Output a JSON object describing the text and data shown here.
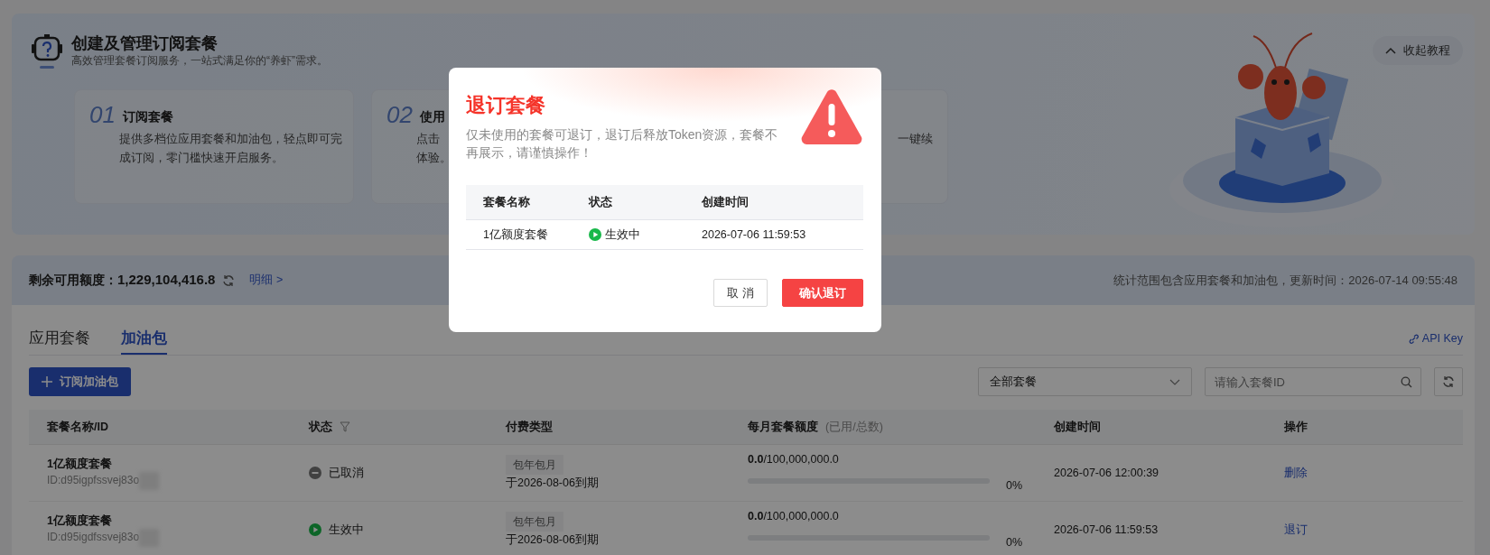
{
  "banner": {
    "title": "创建及管理订阅套餐",
    "subtitle": "高效管理套餐订阅服务，一站式满足你的“养虾”需求。",
    "collapse_button": "收起教程",
    "steps": [
      {
        "number": "01",
        "title": "订阅套餐",
        "lines": [
          "提供多档位应用套餐和加油包，轻点即可完",
          "成订阅，零门槛快速开启服务。"
        ]
      },
      {
        "number": "02",
        "title": "使用",
        "lines": [
          "点击",
          "体验。"
        ]
      },
      {
        "lines": [
          "一键续"
        ]
      }
    ]
  },
  "quota": {
    "label": "剩余可用额度：",
    "value": "1,229,104,416.8",
    "detail_link": "明细 >",
    "note": "统计范围包含应用套餐和加油包，更新时间：2026-07-14 09:55:48"
  },
  "tabs": [
    {
      "label": "应用套餐",
      "selected": false
    },
    {
      "label": "加油包",
      "selected": true
    }
  ],
  "api_key_link": "API Key",
  "subscribe_button": "订阅加油包",
  "filter_select": {
    "value": "全部套餐"
  },
  "search": {
    "placeholder": "请输入套餐ID"
  },
  "table": {
    "columns": [
      {
        "label": "套餐名称/ID"
      },
      {
        "label": "状态",
        "filter": true
      },
      {
        "label": "付费类型"
      },
      {
        "label": "每月套餐额度",
        "hint": "(已用/总数)"
      },
      {
        "label": "创建时间"
      },
      {
        "label": "操作"
      }
    ],
    "rows": [
      {
        "name": "1亿额度套餐",
        "id": "ID:d95igpfssvej83o",
        "status": "已取消",
        "kind": "cancelled",
        "billing_tag": "包年包月",
        "expiry": "于2026-08-06到期",
        "used": "0.0",
        "total": "/100,000,000.0",
        "level": 0,
        "percent": "0%",
        "created": "2026-07-06 12:00:39",
        "action": "删除"
      },
      {
        "name": "1亿额度套餐",
        "id": "ID:d95igdfssvej83o",
        "status": "生效中",
        "kind": "active",
        "billing_tag": "包年包月",
        "expiry": "于2026-08-06到期",
        "used": "0.0",
        "total": "/100,000,000.0",
        "level": 0,
        "percent": "0%",
        "created": "2026-07-06 11:59:53",
        "action": "退订"
      }
    ]
  },
  "modal": {
    "title": "退订套餐",
    "description": "仅未使用的套餐可退订，退订后释放Token资源，套餐不再展示，请谨慎操作！",
    "columns": [
      "套餐名称",
      "状态",
      "创建时间"
    ],
    "rows": [
      {
        "name": "1亿额度套餐",
        "status": "生效中",
        "kind": "active",
        "created": "2026-07-06 11:59:53"
      }
    ],
    "buttons": [
      {
        "label": "取 消",
        "kind": "secondary"
      },
      {
        "label": "确认退订",
        "kind": "danger"
      }
    ]
  }
}
